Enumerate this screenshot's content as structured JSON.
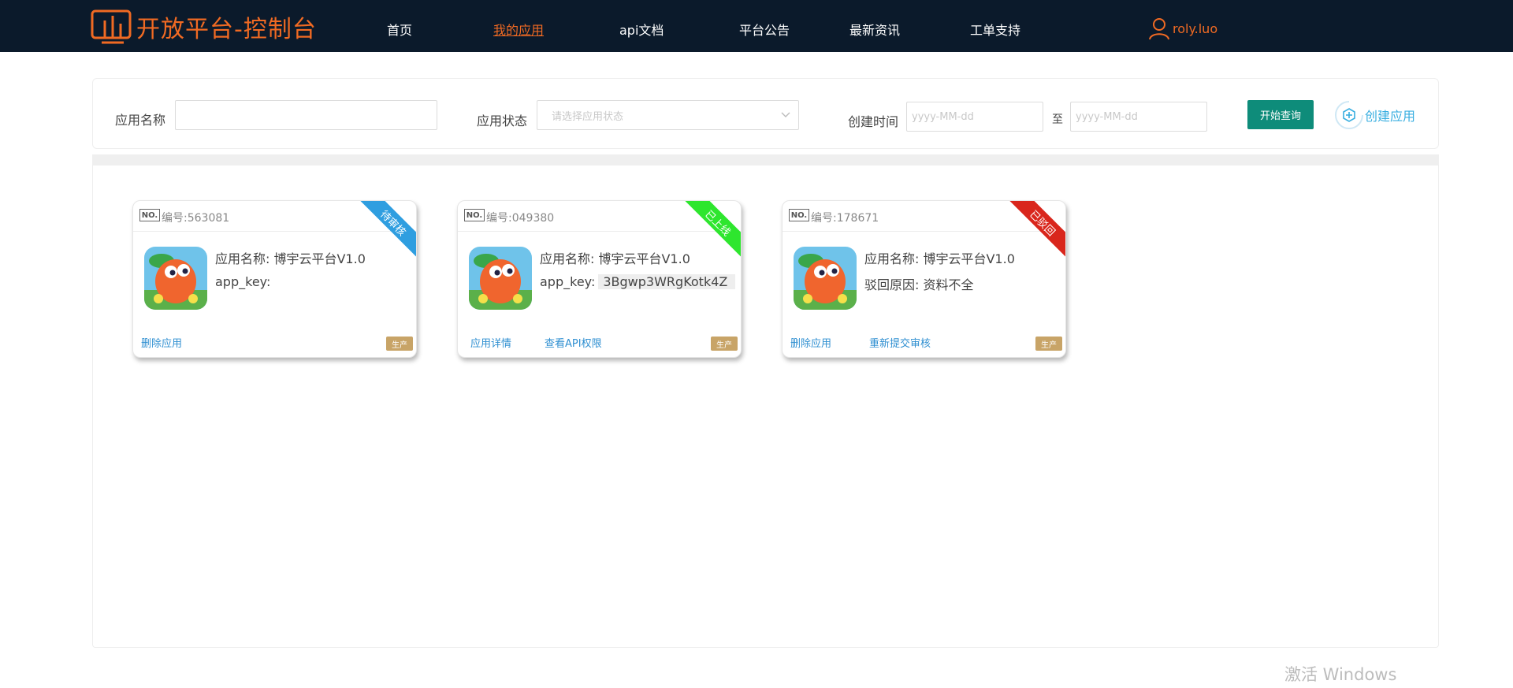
{
  "header": {
    "title": "开放平台-控制台",
    "nav": [
      "首页",
      "我的应用",
      "api文档",
      "平台公告",
      "最新资讯",
      "工单支持"
    ],
    "active_nav": "我的应用",
    "user": "roly.luo"
  },
  "search": {
    "app_name_label": "应用名称",
    "app_name_value": "",
    "status_label": "应用状态",
    "status_placeholder": "请选择应用状态",
    "created_label": "创建时间",
    "date_from_placeholder": "yyyy-MM-dd",
    "date_sep": "至",
    "date_to_placeholder": "yyyy-MM-dd",
    "query_button": "开始查询",
    "create_button": "创建应用"
  },
  "cards": [
    {
      "no_badge": "NO.",
      "number": "编号:563081",
      "status": "待审核",
      "status_color": "#2f9ee0",
      "name_line": "应用名称: 博宇云平台V1.0",
      "line2_label": "app_key:",
      "line2_value": "",
      "actions": [
        "删除应用"
      ],
      "env": "生产"
    },
    {
      "no_badge": "NO.",
      "number": "编号:049380",
      "status": "已上线",
      "status_color": "#2ee62e",
      "name_line": "应用名称: 博宇云平台V1.0",
      "line2_label": "app_key:",
      "line2_value": "3Bgwp3WRgKotk4Z",
      "actions": [
        "应用详情",
        "查看API权限"
      ],
      "env": "生产"
    },
    {
      "no_badge": "NO.",
      "number": "编号:178671",
      "status": "已驳回",
      "status_color": "#d9261c",
      "name_line": "应用名称: 博宇云平台V1.0",
      "line2_label": "驳回原因: 资料不全",
      "line2_value": "",
      "actions": [
        "删除应用",
        "重新提交审核"
      ],
      "env": "生产"
    }
  ],
  "watermark": "激活 Windows",
  "colors": {
    "nav_bg": "#0b1a2b",
    "brand": "#f06a23",
    "primary_button": "#0e8c7a",
    "link": "#2f8fd1"
  }
}
